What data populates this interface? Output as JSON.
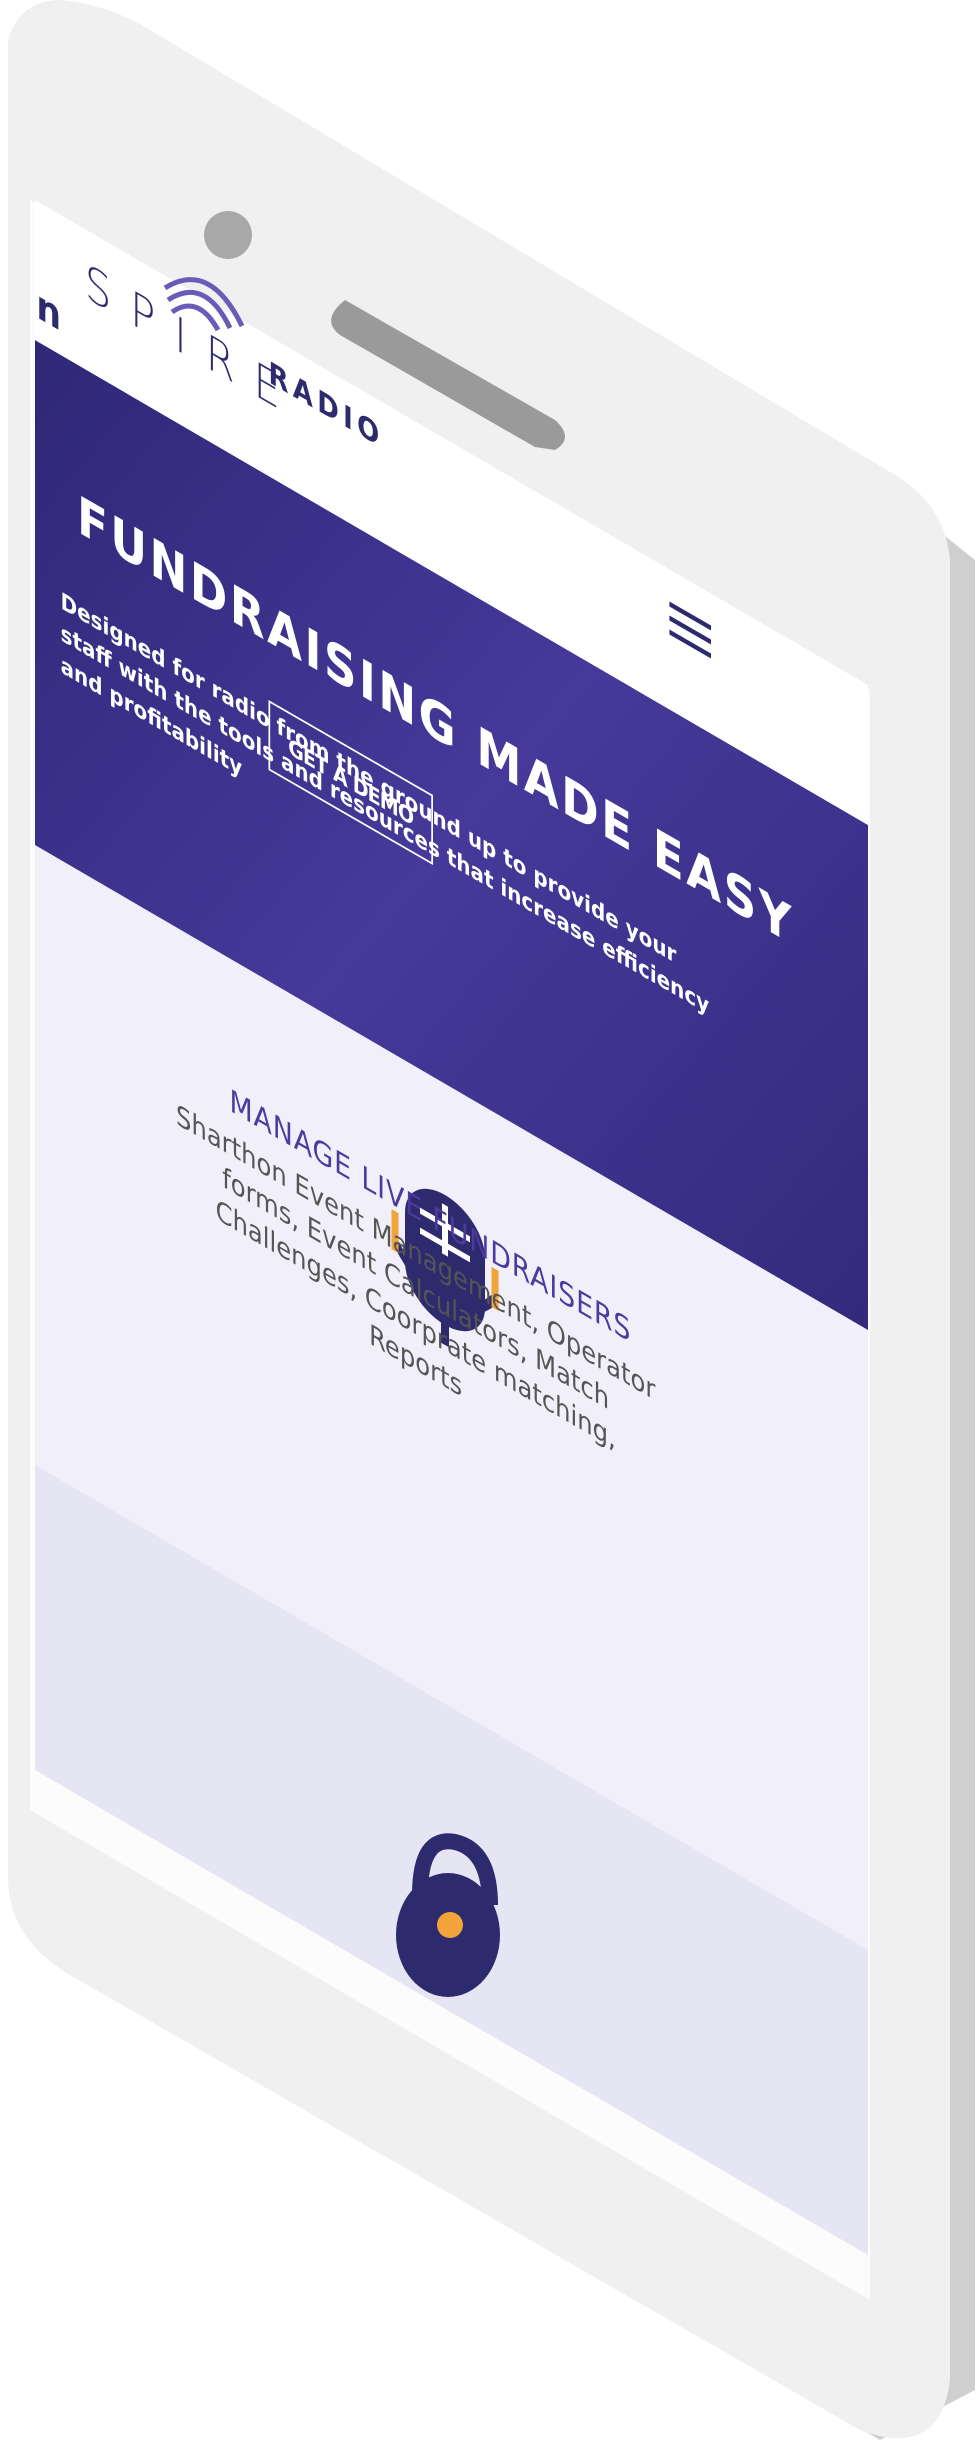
{
  "brand": {
    "logo_n": "n",
    "logo_spire": "SPIRE",
    "logo_radio": "RADIO"
  },
  "hero": {
    "title": "FUNDRAISING MADE EASY",
    "subtitle": "Designed for radio from the ground up to provide your staff with the tools and resources that increase efficiency and profitability",
    "cta_label": "GET A DEMO"
  },
  "feature": {
    "title": "MANAGE LIVE FUNDRAISERS",
    "description": "Sharthon Event Management, Operator forms, Event Calculators, Match Challenges, Coorprate matching, Reports"
  },
  "icons": {
    "menu": "hamburger-menu-icon",
    "feature": "microphone-icon",
    "next_feature": "lock-icon"
  },
  "colors": {
    "brand_navy": "#2e2a6e",
    "hero_purple": "#3e3189",
    "accent_orange": "#f2a33a",
    "feature_title": "#4e3a9e",
    "section_bg": "#f1f0fa",
    "section_alt_bg": "#e6e5f4"
  }
}
